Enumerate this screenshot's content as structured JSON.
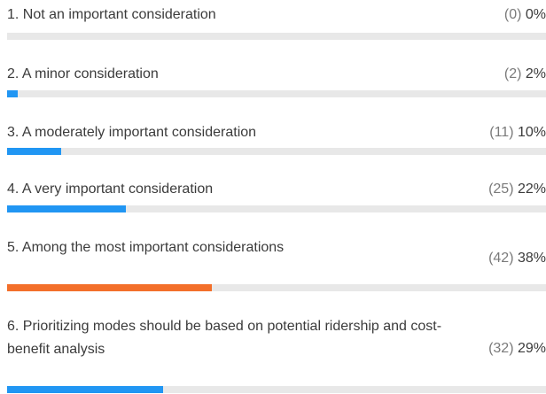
{
  "options": [
    {
      "label": "1. Not an important consideration",
      "count": "(0)",
      "percent": "0%",
      "fraction": 0.0,
      "highlight": false
    },
    {
      "label": "2. A minor consideration",
      "count": "(2)",
      "percent": "2%",
      "fraction": 0.02,
      "highlight": false
    },
    {
      "label": "3. A moderately important consideration",
      "count": "(11)",
      "percent": "10%",
      "fraction": 0.1,
      "highlight": false
    },
    {
      "label": "4. A very important consideration",
      "count": "(25)",
      "percent": "22%",
      "fraction": 0.22,
      "highlight": false
    },
    {
      "label": "5. Among the most important considerations",
      "count": "(42)",
      "percent": "38%",
      "fraction": 0.38,
      "highlight": true
    },
    {
      "label": "6. Prioritizing modes should be based on potential ridership and cost-benefit analysis",
      "count": "(32)",
      "percent": "29%",
      "fraction": 0.29,
      "highlight": false
    }
  ],
  "colors": {
    "bar": "#2196f3",
    "top_bar": "#f36f2a",
    "track": "#e8e8e8"
  }
}
